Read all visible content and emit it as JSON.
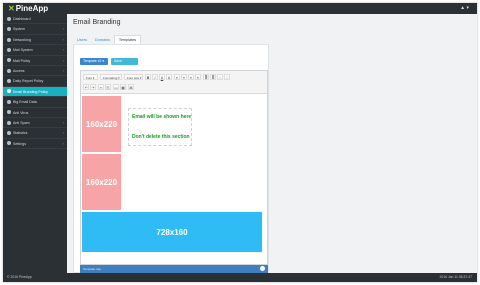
{
  "app": {
    "logo_mark": "✕",
    "logo_text": "PineApp",
    "user_menu": "▲ ▾"
  },
  "sidebar": {
    "items": [
      {
        "label": "Dashboard",
        "chevron": ""
      },
      {
        "label": "System",
        "chevron": "‹"
      },
      {
        "label": "Networking",
        "chevron": "‹"
      },
      {
        "label": "Mail System",
        "chevron": "‹"
      },
      {
        "label": "Mail Policy",
        "chevron": "‹"
      },
      {
        "label": "Access",
        "chevron": "‹"
      },
      {
        "label": "Daily Report Policy",
        "chevron": ""
      },
      {
        "label": "Email Branding Policy",
        "chevron": ""
      },
      {
        "label": "Big Email Data",
        "chevron": ""
      },
      {
        "label": "Anti Virus",
        "chevron": ""
      },
      {
        "label": "Anti Spam",
        "chevron": "‹"
      },
      {
        "label": "Statistics",
        "chevron": "‹"
      },
      {
        "label": "Settings",
        "chevron": "‹"
      }
    ]
  },
  "main": {
    "title": "Email Branding",
    "tabs": [
      {
        "label": "Users"
      },
      {
        "label": "Domains"
      },
      {
        "label": "Templates"
      }
    ],
    "template_select": "Template #1 ▾",
    "save_button": "Save Template",
    "editor": {
      "dropdowns": [
        "Font ▾",
        "Formatting ▾",
        "Font size ▾"
      ],
      "format_buttons": [
        "B",
        "I",
        "U",
        "A",
        "≡",
        "≡",
        "≡",
        "≡",
        "≣",
        "≣",
        "⁝",
        "⁝"
      ],
      "row2_buttons": [
        "↶",
        "↷",
        "✂",
        "⎘",
        "▭",
        "▦",
        "⌘"
      ],
      "placeholder_top": "160x220",
      "placeholder_bottom": "160x220",
      "email_text": "Email will be shown here",
      "warning_text": "Don't delete this section",
      "banner": "728x160"
    },
    "footer_strip_label": "Template rule"
  },
  "footer": {
    "copyright": "© 2016 PineApp",
    "timestamp": "2016 Jan 11 08:37:47"
  }
}
